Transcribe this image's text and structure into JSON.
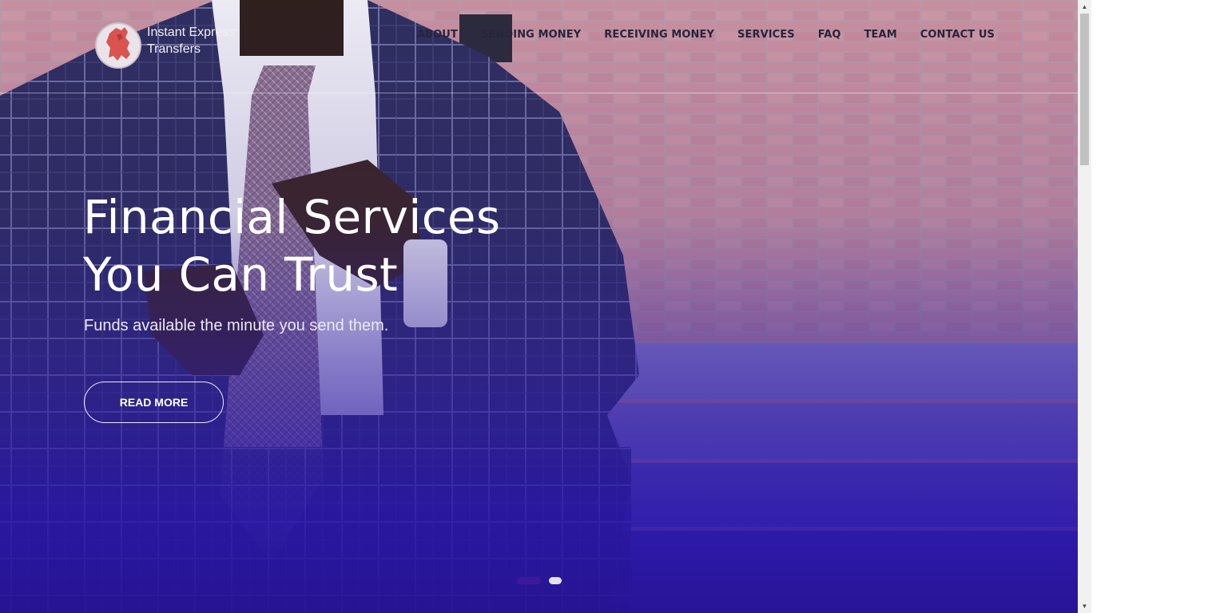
{
  "brand": {
    "name_line1": "Instant Express",
    "name_line2": "Transfers",
    "logo_icon": "red-lion-crest-icon"
  },
  "nav": {
    "items": [
      {
        "label": "ABOUT"
      },
      {
        "label": "SENDING MONEY"
      },
      {
        "label": "RECEIVING MONEY"
      },
      {
        "label": "SERVICES"
      },
      {
        "label": "FAQ"
      },
      {
        "label": "TEAM"
      },
      {
        "label": "CONTACT US"
      }
    ]
  },
  "hero": {
    "title_line1": "Financial Services",
    "title_line2": "You Can Trust",
    "subtitle": "Funds available the minute you send them.",
    "cta_label": "READ MORE",
    "slides_total": 2,
    "active_slide": 1
  },
  "colors": {
    "overlay": "#2d1ca0",
    "active_dot": "#3e189a",
    "logo_red": "#d9534f"
  },
  "scrollbar": {
    "up_icon": "scroll-up-arrow-icon",
    "down_icon": "scroll-down-arrow-icon"
  }
}
